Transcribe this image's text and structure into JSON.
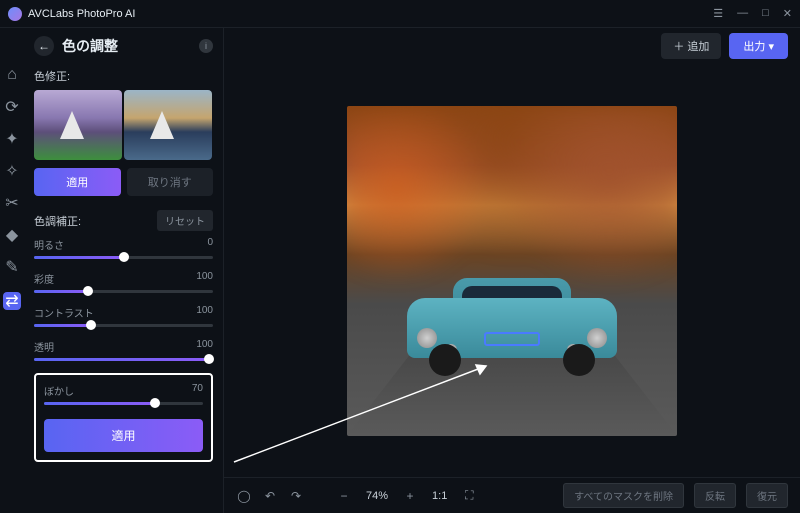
{
  "app": {
    "title": "AVCLabs PhotoPro AI"
  },
  "window_controls": {
    "menu": "☰",
    "min": "—",
    "max": "□",
    "close": "✕"
  },
  "panel": {
    "title": "色の調整",
    "color_fix_label": "色修正:",
    "apply_label": "適用",
    "undo_label": "取り消す",
    "tone_label": "色調補正:",
    "reset_label": "リセット",
    "sliders": {
      "brightness": {
        "label": "明るさ",
        "value": "0",
        "pct": 50
      },
      "saturation": {
        "label": "彩度",
        "value": "100",
        "pct": 30
      },
      "contrast": {
        "label": "コントラスト",
        "value": "100",
        "pct": 32
      },
      "opacity": {
        "label": "透明",
        "value": "100",
        "pct": 98
      },
      "blur": {
        "label": "ぼかし",
        "value": "70",
        "pct": 70
      }
    },
    "apply2_label": "適用"
  },
  "top": {
    "add_label": "＋ 追加",
    "output_label": "出力 ▾"
  },
  "bottom": {
    "zoom": "74%",
    "ratio": "1:1",
    "delete_masks": "すべてのマスクを削除",
    "invert": "反転",
    "restore": "復元"
  }
}
